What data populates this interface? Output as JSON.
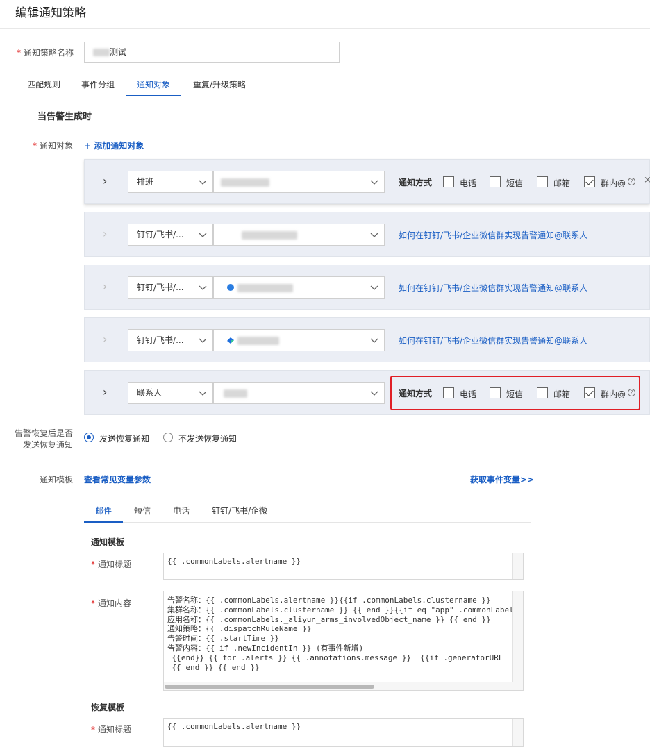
{
  "page": {
    "title": "编辑通知策略"
  },
  "policy_name": {
    "label": "通知策略名称",
    "value": "测试"
  },
  "tabs": [
    "匹配规则",
    "事件分组",
    "通知对象",
    "重复/升级策略"
  ],
  "active_tab": "通知对象",
  "section": {
    "heading": "当告警生成时"
  },
  "targets": {
    "label": "通知对象",
    "add_link": "+ 添加通知对象",
    "method_label": "通知方式",
    "methods": [
      "电话",
      "短信",
      "邮箱",
      "群内@"
    ],
    "help_glyph": "?",
    "close_glyph": "×",
    "cards": [
      {
        "type": "排班",
        "checked": [
          false,
          false,
          false,
          true
        ]
      },
      {
        "type": "钉钉/飞书/...",
        "link": "如何在钉钉/飞书/企业微信群实现告警通知@联系人"
      },
      {
        "type": "钉钉/飞书/...",
        "link": "如何在钉钉/飞书/企业微信群实现告警通知@联系人"
      },
      {
        "type": "钉钉/飞书/...",
        "link": "如何在钉钉/飞书/企业微信群实现告警通知@联系人"
      },
      {
        "type": "联系人",
        "checked": [
          false,
          false,
          false,
          true
        ]
      }
    ]
  },
  "recovery": {
    "label_line1": "告警恢复后是否",
    "label_line2": "发送恢复通知",
    "options": [
      "发送恢复通知",
      "不发送恢复通知"
    ],
    "selected": "发送恢复通知"
  },
  "template": {
    "label": "通知模板",
    "vars_link": "查看常见变量参数",
    "event_vars_link": "获取事件变量>>",
    "tabs": [
      "邮件",
      "短信",
      "电话",
      "钉钉/飞书/企微"
    ],
    "active_tab": "邮件",
    "notify_heading": "通知模板",
    "title_label": "通知标题",
    "title_value": "{{ .commonLabels.alertname }}",
    "content_label": "通知内容",
    "content_lines": [
      "告警名称：{{ .commonLabels.alertname }}{{if .commonLabels.clustername }}",
      "集群名称：{{ .commonLabels.clustername }} {{ end }}{{if eq \"app\" .commonLabels",
      "应用名称：{{ .commonLabels._aliyun_arms_involvedObject_name }} {{ end }}",
      "通知策略：{{ .dispatchRuleName }}",
      "告警时间：{{ .startTime }}",
      "告警内容：{{ if .newIncidentIn }} (有事件新增)",
      " {{end}} {{ for .alerts }} {{ .annotations.message }}  {{if .generatorURL",
      " {{ end }} {{ end }}"
    ],
    "recovery_heading": "恢复模板",
    "recovery_title_label": "通知标题",
    "recovery_title_value": "{{ .commonLabels.alertname }}"
  },
  "colors": {
    "accent": "#1a5ec4",
    "required": "#e02020",
    "highlight_box": "#e01f26",
    "card_bg": "#ebeef5"
  }
}
